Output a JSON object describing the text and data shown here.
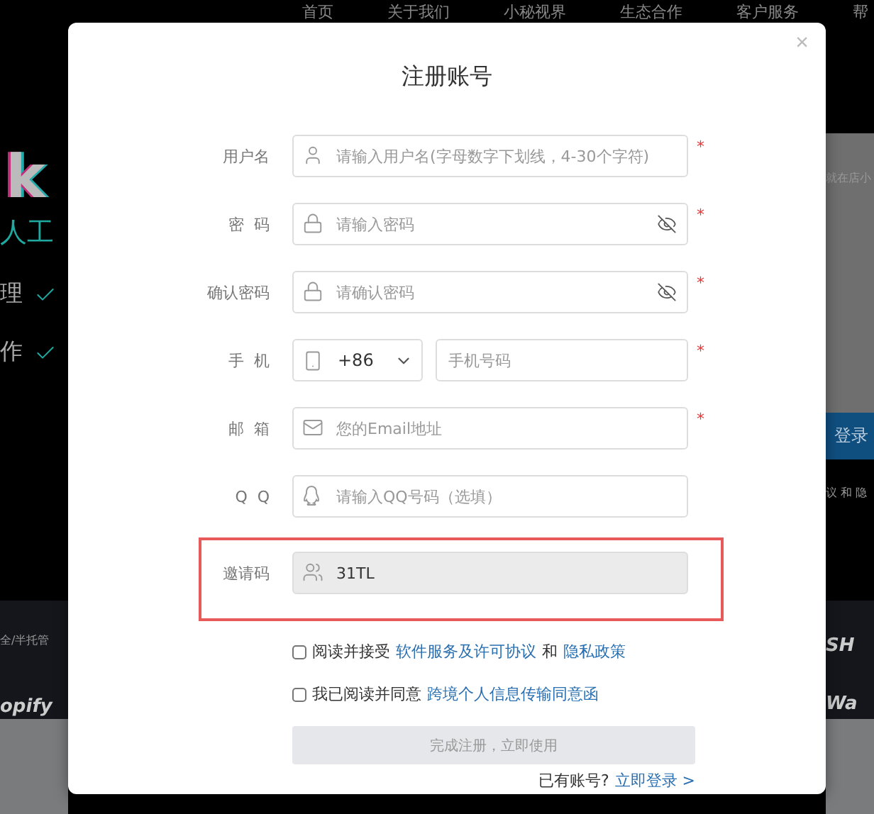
{
  "backdrop": {
    "nav": [
      "首页",
      "关于我们",
      "小秘视界",
      "生态合作",
      "客户服务",
      "帮"
    ],
    "left": [
      {
        "kind": "logo",
        "text": "k"
      },
      {
        "kind": "slogan",
        "text": "人工"
      },
      {
        "kind": "check",
        "text": "理"
      },
      {
        "kind": "check",
        "text": "作"
      },
      {
        "kind": "small",
        "text": "全/半托管"
      },
      {
        "kind": "brand",
        "text": "opify"
      }
    ],
    "right": [
      {
        "kind": "small",
        "text": "就在店小"
      },
      {
        "kind": "button",
        "text": "登录"
      },
      {
        "kind": "small",
        "text": "议 和 隐"
      },
      {
        "kind": "brand",
        "text": "SH"
      },
      {
        "kind": "brand",
        "text": "Wa"
      }
    ]
  },
  "dialog": {
    "title": "注册账号",
    "close": "×",
    "fields": [
      {
        "kind": "user",
        "label": "用户名",
        "placeholder": "请输入用户名(字母数字下划线，4-30个字符)",
        "required_mark": "*"
      },
      {
        "kind": "password",
        "label": "密  码",
        "placeholder": "请输入密码",
        "required_mark": "*"
      },
      {
        "kind": "password",
        "label": "确认密码",
        "placeholder": "请确认密码",
        "required_mark": "*"
      },
      {
        "kind": "phone",
        "label": "手  机",
        "country": "+86",
        "placeholder": "手机号码",
        "required_mark": "*"
      },
      {
        "kind": "email",
        "label": "邮  箱",
        "placeholder": "您的Email地址",
        "required_mark": "*"
      },
      {
        "kind": "qq",
        "label": "Q  Q",
        "placeholder": "请输入QQ号码（选填）"
      },
      {
        "kind": "invite",
        "label": "邀请码",
        "value": "31TL",
        "disabled": true,
        "highlighted": true
      }
    ],
    "agreements": [
      {
        "checked": false,
        "parts": [
          {
            "kind": "text",
            "text": "阅读并接受"
          },
          {
            "kind": "link",
            "text": "软件服务及许可协议"
          },
          {
            "kind": "text",
            "text": "和"
          },
          {
            "kind": "link",
            "text": "隐私政策"
          }
        ]
      },
      {
        "checked": false,
        "parts": [
          {
            "kind": "text",
            "text": "我已阅读并同意"
          },
          {
            "kind": "link",
            "text": "跨境个人信息传输同意函"
          }
        ]
      }
    ],
    "submit": {
      "label": "完成注册，立即使用",
      "disabled": true
    },
    "login": {
      "text": "已有账号?",
      "link": "立即登录 >"
    }
  }
}
